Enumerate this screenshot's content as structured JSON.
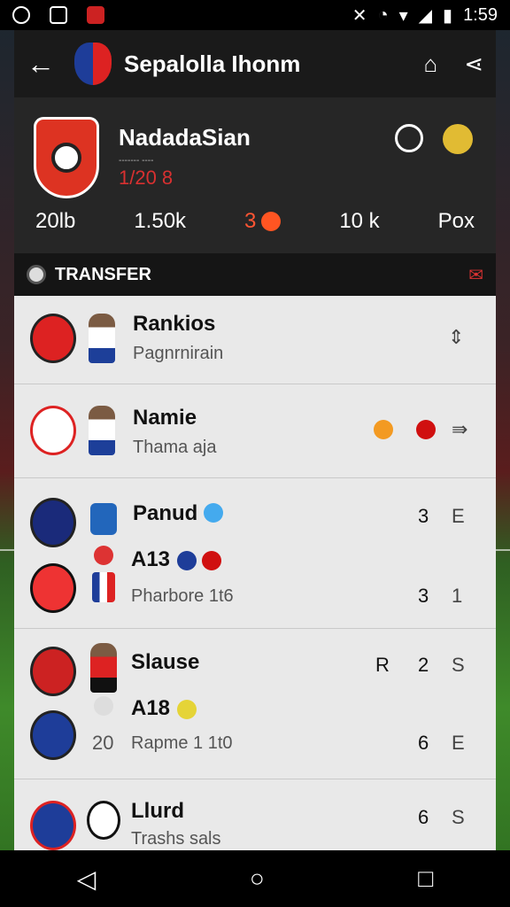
{
  "status_bar": {
    "time": "1:59"
  },
  "app_bar": {
    "title": "Sepalolla Ihonm",
    "back_icon": "back-arrow-icon",
    "action_icons": [
      "profile-icon",
      "share-icon"
    ]
  },
  "hero": {
    "team_name": "NadadaSian",
    "subtitle": "------- ----",
    "score": "1/20 8",
    "stats": [
      "20lb",
      "1.50k",
      "3",
      "10 k",
      "Pox"
    ]
  },
  "section": {
    "label": "TRANSFER"
  },
  "rows": [
    {
      "name": "Rankios",
      "sub": "Pagnrnirain"
    },
    {
      "name": "Namie",
      "sub": "Thama aja"
    },
    {
      "name": "Panud",
      "line2": "A13",
      "sub": "Pharbore 1t6",
      "n1": "3",
      "n2": "3",
      "a1": "E",
      "a2": "1"
    },
    {
      "name": "Slause",
      "line2": "A18",
      "sub": "Rapme 1 1t0",
      "pre": "20",
      "r": "R",
      "n1": "2",
      "n2": "6",
      "a1": "S",
      "a2": "E"
    },
    {
      "name": "Llurd",
      "sub": "Trashs sals",
      "n1": "6",
      "a1": "S"
    }
  ],
  "colors": {
    "accent": "#d83030",
    "panel": "#262626",
    "list_bg": "#e9e9e9"
  }
}
